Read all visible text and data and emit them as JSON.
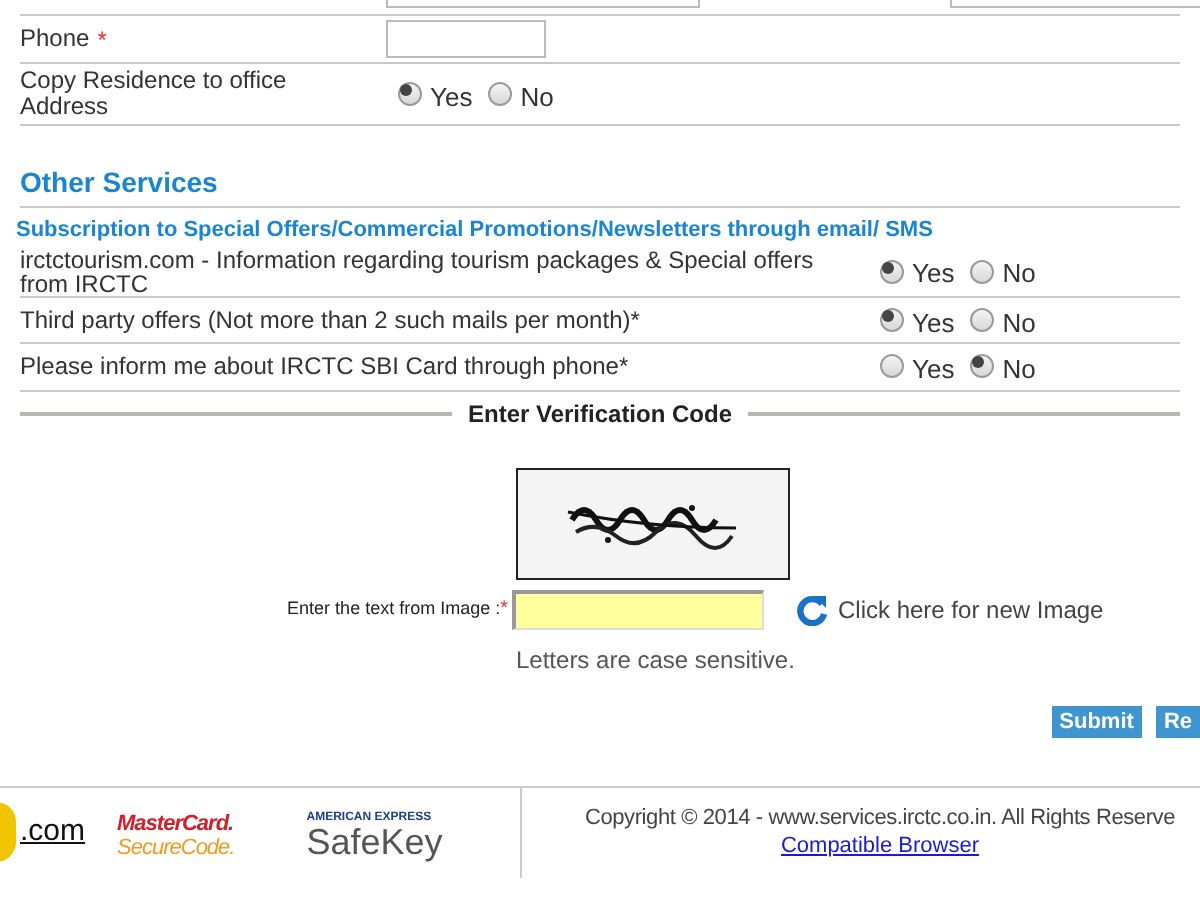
{
  "form_rows": [
    {
      "kind": "text",
      "label": "Phone",
      "required": true,
      "required_mark": "*"
    },
    {
      "kind": "radio",
      "label": "Copy Residence to office Address",
      "options": [
        {
          "label": "Yes",
          "selected": true
        },
        {
          "label": "No",
          "selected": false
        }
      ]
    }
  ],
  "other_services": {
    "title": "Other Services",
    "subtitle": "Subscription to Special Offers/Commercial Promotions/Newsletters through email/ SMS",
    "rows": [
      {
        "label": "irctctourism.com - Information regarding tourism packages & Special offers from IRCTC",
        "options": [
          {
            "label": "Yes",
            "selected": true
          },
          {
            "label": "No",
            "selected": false
          }
        ]
      },
      {
        "label": "Third party offers (Not more than 2 such mails per month)*",
        "options": [
          {
            "label": "Yes",
            "selected": true
          },
          {
            "label": "No",
            "selected": false
          }
        ]
      },
      {
        "label": "Please inform me about IRCTC SBI Card through phone*",
        "options": [
          {
            "label": "Yes",
            "selected": false
          },
          {
            "label": "No",
            "selected": true
          }
        ]
      }
    ]
  },
  "verification": {
    "legend": "Enter Verification Code",
    "field_label": "Enter the text from Image :",
    "required": true,
    "required_mark": "*",
    "refresh_link": "Click here for new Image",
    "hint": "Letters are case sensitive."
  },
  "buttons": [
    "Submit",
    "Re"
  ],
  "footer": {
    "logos": [
      {
        "kind": "tourism",
        "text": ".com"
      },
      {
        "kind": "mastercard",
        "lines": [
          "MasterCard.",
          "SecureCode."
        ]
      },
      {
        "kind": "amex",
        "lines": [
          "AMERICAN EXPRESS",
          "SafeKey"
        ]
      }
    ],
    "copyright": "Copyright © 2014 - www.services.irctc.co.in. All Rights Reserve",
    "link": "Compatible Browser"
  }
}
